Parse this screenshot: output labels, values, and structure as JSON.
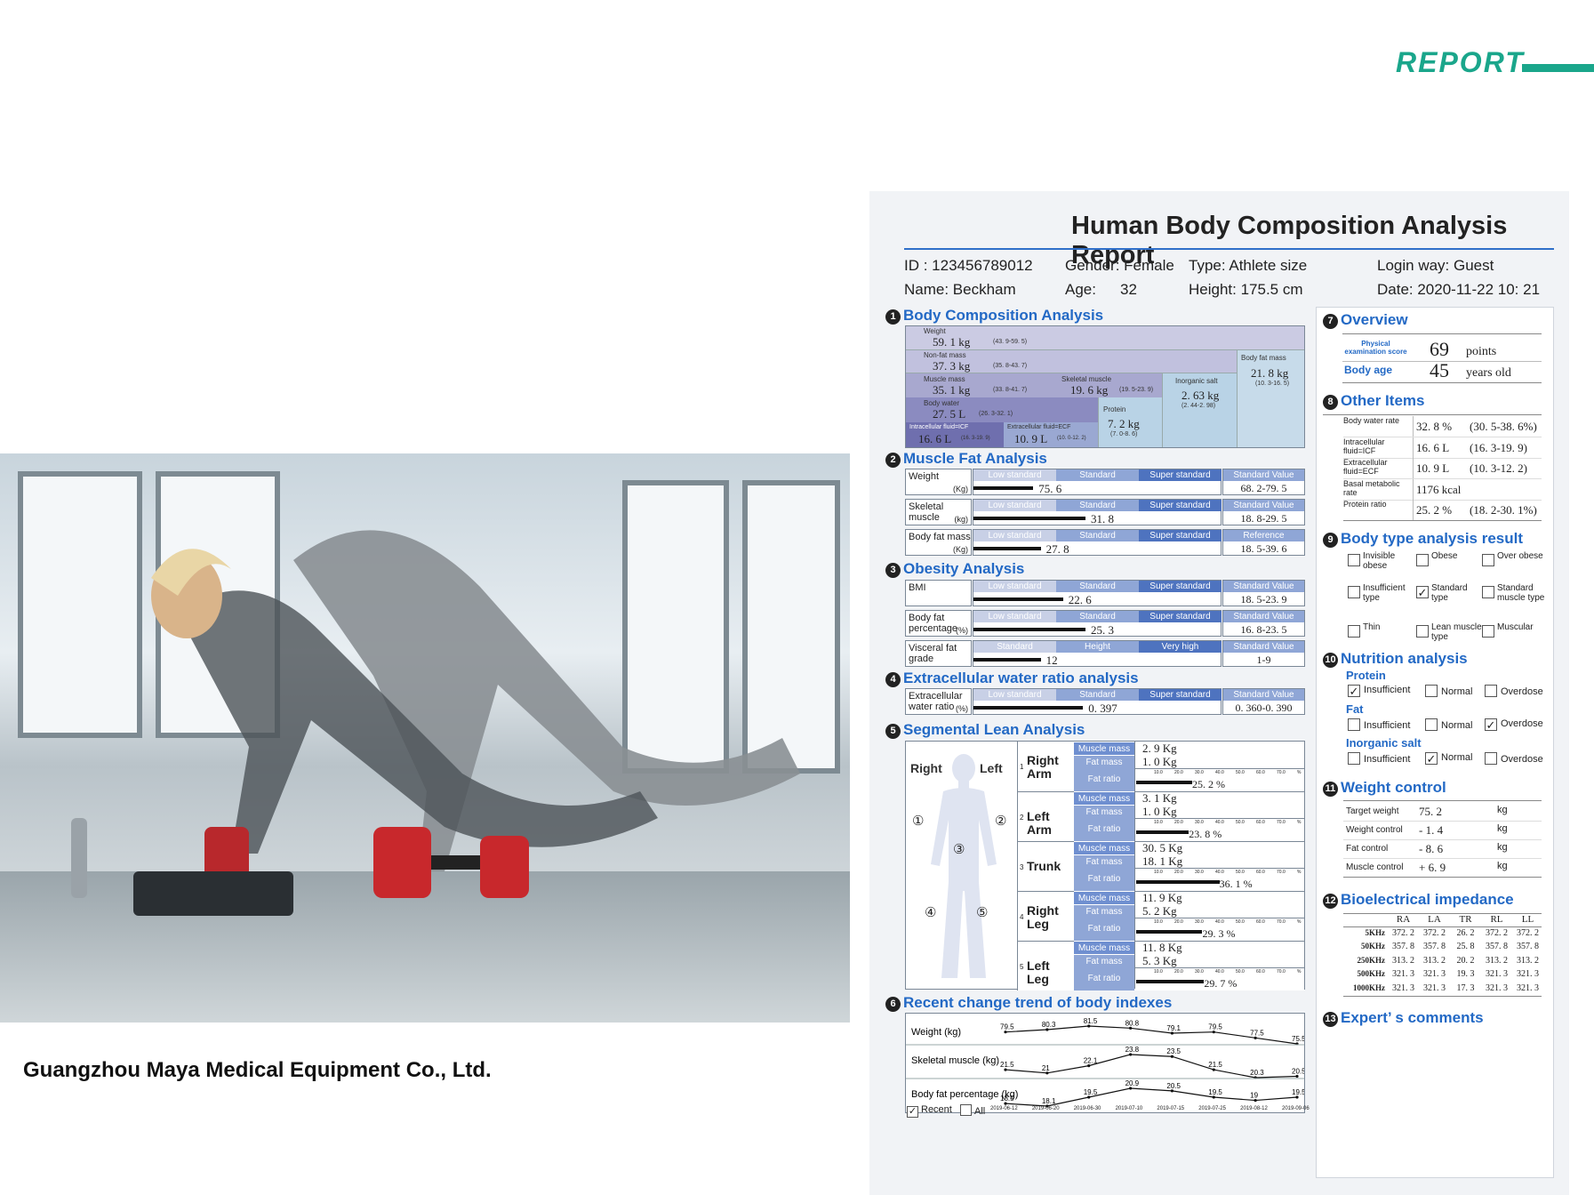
{
  "header": {
    "brand_word": "REPORT"
  },
  "company": "Guangzhou Maya Medical Equipment Co., Ltd.",
  "report": {
    "title": "Human Body Composition Analysis Report",
    "id": "ID : 123456789012",
    "gender": "Gender: Female",
    "type": "Type: Athlete size",
    "login": "Login way: Guest",
    "name": "Name: Beckham",
    "age_label": "Age:",
    "age_value": "32",
    "height": "Height: 175.5 cm",
    "date": "Date: 2020-11-22 10: 21"
  },
  "s1": {
    "num": "1",
    "title": "Body Composition Analysis",
    "weight_label": "Weight",
    "weight_val": "59. 1  kg",
    "weight_rng": "(43. 9-59. 5)",
    "nonfat_label": "Non-fat mass",
    "nonfat_val": "37. 3  kg",
    "nonfat_rng": "(35. 8-43. 7)",
    "bodyfat_label": "Body fat mass",
    "bodyfat_val": "21. 8  kg",
    "bodyfat_rng": "(10. 3-16. 5)",
    "muscle_label": "Muscle mass",
    "muscle_val": "35. 1  kg",
    "muscle_rng": "(33. 8-41. 7)",
    "skeletal_label": "Skeletal muscle",
    "skeletal_val": "19. 6  kg",
    "skeletal_rng": "(19. 5-23. 9)",
    "inorg_label": "Inorganic salt",
    "inorg_val": "2. 63  kg",
    "inorg_rng": "(2. 44-2. 98)",
    "water_label": "Body water",
    "water_val": "27. 5  L",
    "water_rng": "(26. 3-32. 1)",
    "protein_label": "Protein",
    "protein_val": "7. 2  kg",
    "protein_rng": "(7. 0-8. 6)",
    "icf_label": "Intracellular fluid=ICF",
    "icf_val": "16. 6  L",
    "icf_rng": "(16. 3-19. 9)",
    "ecf_label": "Extracellular fluid=ECF",
    "ecf_val": "10. 9  L",
    "ecf_rng": "(10. 0-12. 2)"
  },
  "s2": {
    "num": "2",
    "title": "Muscle Fat Analysis",
    "rows": [
      {
        "label": "Weight",
        "unit": "(Kg)",
        "h1": "Low standard",
        "h2": "Standard",
        "h3": "Super standard",
        "hv": "Standard Value",
        "value": "75. 6",
        "fill": 0.24,
        "std": "68. 2-79. 5"
      },
      {
        "label": "Skeletal muscle",
        "unit": "(kg)",
        "h1": "Low standard",
        "h2": "Standard",
        "h3": "Super standard",
        "hv": "Standard Value",
        "value": "31. 8",
        "fill": 0.45,
        "std": "18. 8-29. 5"
      },
      {
        "label": "Body fat mass",
        "unit": "(Kg)",
        "h1": "Low standard",
        "h2": "Standard",
        "h3": "Super standard",
        "hv": "Reference",
        "value": "27. 8",
        "fill": 0.27,
        "std": "18. 5-39. 6"
      }
    ]
  },
  "s3": {
    "num": "3",
    "title": "Obesity Analysis",
    "rows": [
      {
        "label": "BMI",
        "unit": "",
        "h1": "Low standard",
        "h2": "Standard",
        "h3": "Super standard",
        "hv": "Standard Value",
        "value": "22. 6",
        "fill": 0.36,
        "std": "18. 5-23. 9"
      },
      {
        "label": "Body fat percentage",
        "unit": "(%)",
        "h1": "Low standard",
        "h2": "Standard",
        "h3": "Super standard",
        "hv": "Standard Value",
        "value": "25. 3",
        "fill": 0.45,
        "std": "16. 8-23. 5"
      },
      {
        "label": "Visceral fat grade",
        "unit": "",
        "h1": "Standard",
        "h2": "Height",
        "h3": "Very high",
        "hv": "Standard Value",
        "value": "12",
        "fill": 0.27,
        "std": "1-9"
      }
    ]
  },
  "s4": {
    "num": "4",
    "title": "Extracellular water ratio analysis",
    "row": {
      "label": "Extracellular water ratio",
      "unit": "(%)",
      "h1": "Low standard",
      "h2": "Standard",
      "h3": "Super standard",
      "hv": "Standard Value",
      "value": "0. 397",
      "fill": 0.44,
      "std": "0. 360-0. 390"
    }
  },
  "s5": {
    "num": "5",
    "title": "Segmental Lean Analysis",
    "right": "Right",
    "left": "Left",
    "markers": [
      "①",
      "②",
      "③",
      "④",
      "⑤"
    ],
    "k_muscle": "Muscle mass",
    "k_fat": "Fat mass",
    "k_ratio": "Fat ratio",
    "ticks": [
      "10.0",
      "20.0",
      "30.0",
      "40.0",
      "50.0",
      "60.0",
      "70.0",
      "%"
    ],
    "segments": [
      {
        "n": "1",
        "name": "Right Arm",
        "muscle": "2. 9  Kg",
        "fat": "1. 0  Kg",
        "ratio": "25. 2  %",
        "fill": 0.33
      },
      {
        "n": "2",
        "name": "Left Arm",
        "muscle": "3. 1  Kg",
        "fat": "1. 0  Kg",
        "ratio": "23. 8  %",
        "fill": 0.31
      },
      {
        "n": "3",
        "name": "Trunk",
        "muscle": "30. 5  Kg",
        "fat": "18. 1  Kg",
        "ratio": "36. 1  %",
        "fill": 0.49
      },
      {
        "n": "4",
        "name": "Right Leg",
        "muscle": "11. 9  Kg",
        "fat": "5. 2  Kg",
        "ratio": "29. 3  %",
        "fill": 0.39
      },
      {
        "n": "5",
        "name": "Left Leg",
        "muscle": "11. 8  Kg",
        "fat": "5. 3  Kg",
        "ratio": "29. 7  %",
        "fill": 0.4
      }
    ]
  },
  "s6": {
    "num": "6",
    "title": "Recent change trend of body indexes",
    "recent": "Recent",
    "all": "All",
    "chart_data": {
      "type": "line",
      "x": [
        "2019-06-12",
        "2019-06-20",
        "2019-06-30",
        "2019-07-10",
        "2019-07-15",
        "2019-07-25",
        "2019-08-12",
        "2019-09-06"
      ],
      "series": [
        {
          "name": "Weight  (kg)",
          "values": [
            79.5,
            80.3,
            81.5,
            80.8,
            79.1,
            79.5,
            77.5,
            75.5
          ]
        },
        {
          "name": "Skeletal muscle (kg)",
          "values": [
            21.5,
            21.0,
            22.1,
            23.8,
            23.5,
            21.5,
            20.3,
            20.5
          ]
        },
        {
          "name": "Body fat percentage  (kg)",
          "values": [
            18.5,
            18.1,
            19.5,
            20.9,
            20.5,
            19.5,
            19.0,
            19.5
          ]
        }
      ]
    }
  },
  "s7": {
    "num": "7",
    "title": "Overview",
    "score_label": "Physical examination score",
    "score": "69",
    "score_unit": "points",
    "age_label": "Body age",
    "age": "45",
    "age_unit": "years old"
  },
  "s8": {
    "num": "8",
    "title": "Other Items",
    "rows": [
      {
        "label": "Body water rate",
        "value": "32. 8  %",
        "range": "(30. 5-38. 6%)"
      },
      {
        "label": "Intracellular fluid=ICF",
        "value": "16. 6  L",
        "range": "(16. 3-19. 9)"
      },
      {
        "label": "Extracellular fluid=ECF",
        "value": "10. 9  L",
        "range": "(10. 3-12. 2)"
      },
      {
        "label": "Basal metabolic rate",
        "value": "1176  kcal",
        "range": ""
      },
      {
        "label": "Protein ratio",
        "value": "25. 2  %",
        "range": "(18. 2-30. 1%)"
      }
    ]
  },
  "s9": {
    "num": "9",
    "title": "Body type analysis result",
    "options": [
      {
        "label": "Invisible obese",
        "checked": false
      },
      {
        "label": "Obese",
        "checked": false
      },
      {
        "label": "Over obese",
        "checked": false
      },
      {
        "label": "Insufficient type",
        "checked": false
      },
      {
        "label": "Standard type",
        "checked": true
      },
      {
        "label": "Standard muscle type",
        "checked": false
      },
      {
        "label": "Thin",
        "checked": false
      },
      {
        "label": "Lean muscle type",
        "checked": false
      },
      {
        "label": "Muscular",
        "checked": false
      }
    ]
  },
  "s10": {
    "num": "10",
    "title": "Nutrition analysis",
    "groups": [
      {
        "name": "Protein",
        "opts": [
          "Insufficient",
          "Normal",
          "Overdose"
        ],
        "checked": 0
      },
      {
        "name": "Fat",
        "opts": [
          "Insufficient",
          "Normal",
          "Overdose"
        ],
        "checked": 2
      },
      {
        "name": "Inorganic salt",
        "opts": [
          "Insufficient",
          "Normal",
          "Overdose"
        ],
        "checked": 1
      }
    ]
  },
  "s11": {
    "num": "11",
    "title": "Weight control",
    "rows": [
      {
        "label": "Target weight",
        "value": "75. 2",
        "unit": "kg"
      },
      {
        "label": "Weight control",
        "value": "- 1. 4",
        "unit": "kg"
      },
      {
        "label": "Fat control",
        "value": "- 8. 6",
        "unit": "kg"
      },
      {
        "label": "Muscle control",
        "value": "+ 6. 9",
        "unit": "kg"
      }
    ]
  },
  "s12": {
    "num": "12",
    "title": "Bioelectrical impedance",
    "cols": [
      "RA",
      "LA",
      "TR",
      "RL",
      "LL"
    ],
    "rows": [
      {
        "f": "5KHz",
        "v": [
          "372. 2",
          "372. 2",
          "26. 2",
          "372. 2",
          "372. 2"
        ]
      },
      {
        "f": "50KHz",
        "v": [
          "357. 8",
          "357. 8",
          "25. 8",
          "357. 8",
          "357. 8"
        ]
      },
      {
        "f": "250KHz",
        "v": [
          "313. 2",
          "313. 2",
          "20. 2",
          "313. 2",
          "313. 2"
        ]
      },
      {
        "f": "500KHz",
        "v": [
          "321. 3",
          "321. 3",
          "19. 3",
          "321. 3",
          "321. 3"
        ]
      },
      {
        "f": "1000KHz",
        "v": [
          "321. 3",
          "321. 3",
          "17. 3",
          "321. 3",
          "321. 3"
        ]
      }
    ]
  },
  "s13": {
    "num": "13",
    "title": "Expert’ s comments"
  },
  "colors": {
    "accent": "#2369c5",
    "teal": "#1aa68b",
    "header_bar": "#8fa6d6"
  }
}
